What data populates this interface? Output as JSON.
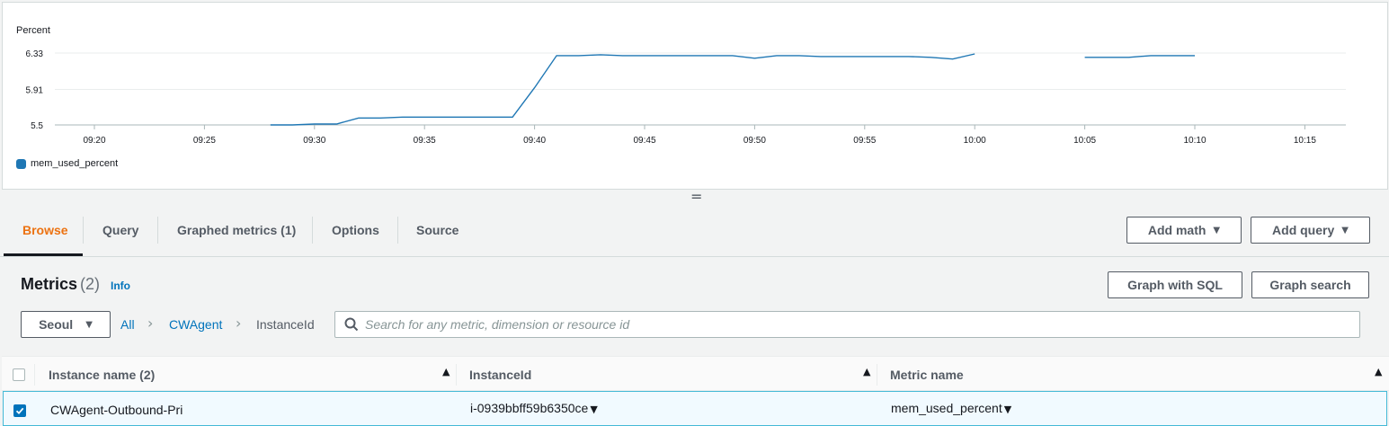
{
  "chart_data": {
    "type": "line",
    "ylabel": "Percent",
    "y_ticks": [
      "6.33",
      "5.91",
      "5.5"
    ],
    "ylim": [
      5.5,
      6.33
    ],
    "x_ticks": [
      "09:20",
      "09:25",
      "09:30",
      "09:35",
      "09:40",
      "09:45",
      "09:50",
      "09:55",
      "10:00",
      "10:05",
      "10:10",
      "10:15"
    ],
    "series": [
      {
        "name": "mem_used_percent",
        "color": "#1f77b4",
        "segments": [
          [
            {
              "t": "09:28",
              "y": 5.5
            },
            {
              "t": "09:29",
              "y": 5.5
            },
            {
              "t": "09:30",
              "y": 5.51
            },
            {
              "t": "09:31",
              "y": 5.51
            },
            {
              "t": "09:32",
              "y": 5.58
            },
            {
              "t": "09:33",
              "y": 5.58
            },
            {
              "t": "09:34",
              "y": 5.59
            },
            {
              "t": "09:35",
              "y": 5.59
            },
            {
              "t": "09:36",
              "y": 5.59
            },
            {
              "t": "09:37",
              "y": 5.59
            },
            {
              "t": "09:38",
              "y": 5.59
            },
            {
              "t": "09:39",
              "y": 5.59
            },
            {
              "t": "09:40",
              "y": 5.93
            },
            {
              "t": "09:41",
              "y": 6.3
            },
            {
              "t": "09:42",
              "y": 6.3
            },
            {
              "t": "09:43",
              "y": 6.31
            },
            {
              "t": "09:44",
              "y": 6.3
            },
            {
              "t": "09:45",
              "y": 6.3
            },
            {
              "t": "09:46",
              "y": 6.3
            },
            {
              "t": "09:47",
              "y": 6.3
            },
            {
              "t": "09:48",
              "y": 6.3
            },
            {
              "t": "09:49",
              "y": 6.3
            },
            {
              "t": "09:50",
              "y": 6.27
            },
            {
              "t": "09:51",
              "y": 6.3
            },
            {
              "t": "09:52",
              "y": 6.3
            },
            {
              "t": "09:53",
              "y": 6.29
            },
            {
              "t": "09:54",
              "y": 6.29
            },
            {
              "t": "09:55",
              "y": 6.29
            },
            {
              "t": "09:56",
              "y": 6.29
            },
            {
              "t": "09:57",
              "y": 6.29
            },
            {
              "t": "09:58",
              "y": 6.28
            },
            {
              "t": "09:59",
              "y": 6.26
            },
            {
              "t": "10:00",
              "y": 6.32
            }
          ],
          [
            {
              "t": "10:05",
              "y": 6.28
            },
            {
              "t": "10:06",
              "y": 6.28
            },
            {
              "t": "10:07",
              "y": 6.28
            },
            {
              "t": "10:08",
              "y": 6.3
            },
            {
              "t": "10:09",
              "y": 6.3
            },
            {
              "t": "10:10",
              "y": 6.3
            }
          ]
        ]
      }
    ],
    "grid": "horizontal",
    "legend": "bottom-left"
  },
  "resize_handle": "=",
  "tabs": [
    {
      "label": "Browse",
      "active": true
    },
    {
      "label": "Query",
      "active": false
    },
    {
      "label": "Graphed metrics (1)",
      "active": false
    },
    {
      "label": "Options",
      "active": false
    },
    {
      "label": "Source",
      "active": false
    }
  ],
  "toolbar": {
    "add_math": "Add math",
    "add_query": "Add query",
    "graph_with_sql": "Graph with SQL",
    "graph_search": "Graph search"
  },
  "metrics": {
    "title": "Metrics",
    "count": "(2)",
    "info": "Info"
  },
  "region": "Seoul",
  "breadcrumb": [
    "All",
    "CWAgent",
    "InstanceId"
  ],
  "search": {
    "placeholder": "Search for any metric, dimension or resource id",
    "value": ""
  },
  "table": {
    "columns": [
      "Instance name (2)",
      "InstanceId",
      "Metric name"
    ],
    "rows": [
      {
        "checked": true,
        "instance_name": "CWAgent-Outbound-Pri",
        "instance_id": "i-0939bbff59b6350ce",
        "metric_name": "mem_used_percent"
      }
    ]
  }
}
